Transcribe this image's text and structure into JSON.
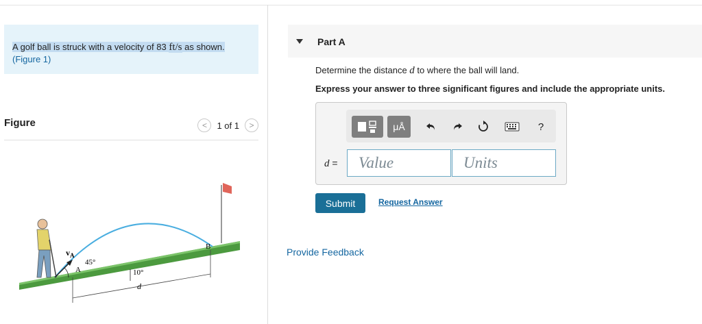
{
  "problem": {
    "text_before": "A golf ball is struck with a velocity of 83 ",
    "units": "ft/s",
    "text_after": " as shown.",
    "figure_link": "(Figure 1)"
  },
  "figure": {
    "title": "Figure",
    "pager": "1 of 1",
    "prev": "<",
    "next": ">",
    "labels": {
      "velocity": "v",
      "velocity_sub": "A",
      "launch_angle": "45°",
      "point_a": "A",
      "point_b": "B",
      "slope_angle": "10°",
      "distance": "d"
    }
  },
  "part": {
    "title": "Part A",
    "question_before": "Determine the distance ",
    "question_var": "d",
    "question_after": " to where the ball will land.",
    "instruction": "Express your answer to three significant figures and include the appropriate units."
  },
  "answer": {
    "toolbar": {
      "templates": "templates",
      "symbols": "μÅ",
      "help": "?"
    },
    "variable": "d",
    "equals": " =",
    "value_placeholder": "Value",
    "units_placeholder": "Units"
  },
  "buttons": {
    "submit": "Submit",
    "request_answer": "Request Answer",
    "provide_feedback": "Provide Feedback"
  },
  "colors": {
    "problem_bg": "#e5f3fa",
    "highlight": "#c3dcf1",
    "link": "#1466a0",
    "submit_bg": "#1a6f97",
    "ground": "#4c9a3f",
    "trajectory": "#4aaee0"
  }
}
